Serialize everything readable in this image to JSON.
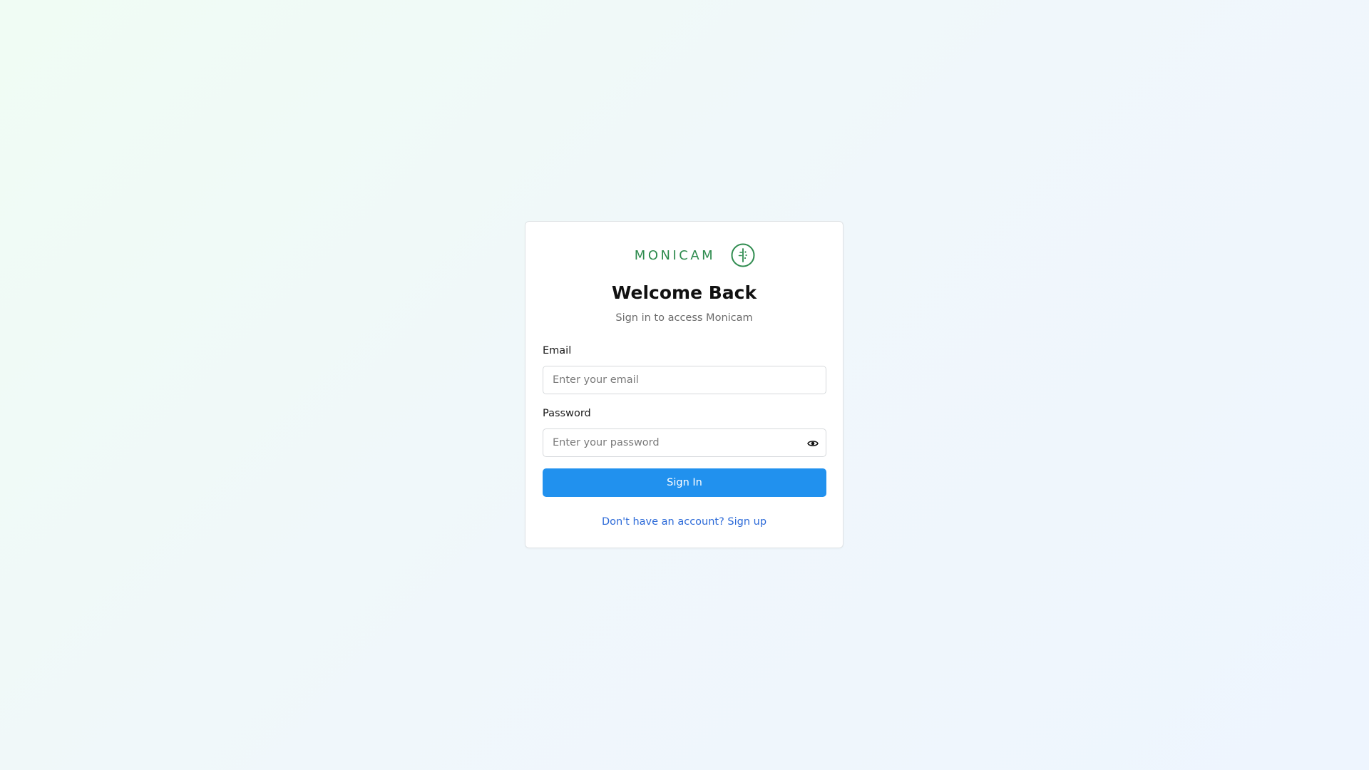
{
  "brand": {
    "name": "MONICAM",
    "logo_icon": "monicam-logo-icon",
    "color": "#2e8b4e"
  },
  "login": {
    "title": "Welcome Back",
    "subtitle": "Sign in to access Monicam",
    "email": {
      "label": "Email",
      "placeholder": "Enter your email",
      "value": ""
    },
    "password": {
      "label": "Password",
      "placeholder": "Enter your password",
      "value": "",
      "toggle_icon": "eye-icon"
    },
    "submit_label": "Sign In",
    "signup_link": "Don't have an account? Sign up"
  },
  "colors": {
    "accent": "#2191ee",
    "link": "#2c6ad8"
  }
}
